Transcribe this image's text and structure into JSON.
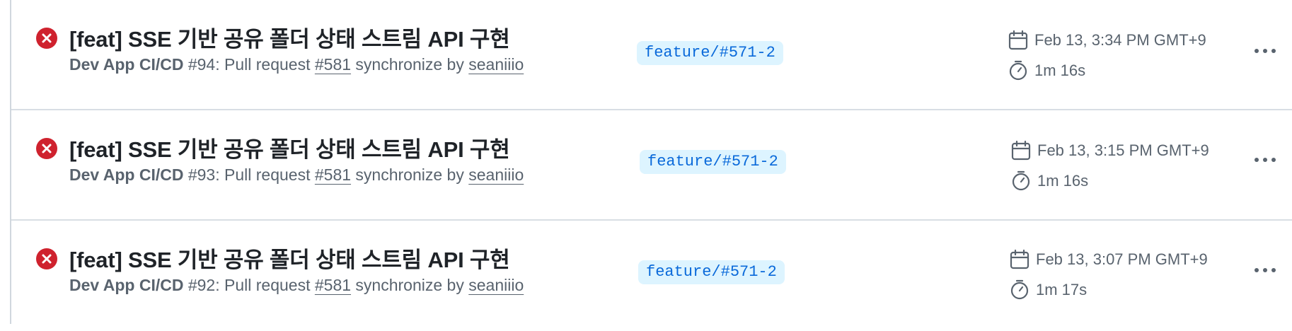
{
  "runs": [
    {
      "title": "[feat] SSE 기반 공유 폴더 상태 스트림 API 구현",
      "workflow": "Dev App CI/CD",
      "run_number": "#94",
      "event_text_1": ": Pull request ",
      "pr": "#581",
      "event_text_2": " synchronize by ",
      "actor": "seaniiio",
      "branch": "feature/#571-2",
      "timestamp": "Feb 13, 3:34 PM GMT+9",
      "duration": "1m 16s",
      "status": "failure"
    },
    {
      "title": "[feat] SSE 기반 공유 폴더 상태 스트림 API 구현",
      "workflow": "Dev App CI/CD",
      "run_number": "#93",
      "event_text_1": ": Pull request ",
      "pr": "#581",
      "event_text_2": " synchronize by ",
      "actor": "seaniiio",
      "branch": "feature/#571-2",
      "timestamp": "Feb 13, 3:15 PM GMT+9",
      "duration": "1m 16s",
      "status": "failure"
    },
    {
      "title": "[feat] SSE 기반 공유 폴더 상태 스트림 API 구현",
      "workflow": "Dev App CI/CD",
      "run_number": "#92",
      "event_text_1": ": Pull request ",
      "pr": "#581",
      "event_text_2": " synchronize by ",
      "actor": "seaniiio",
      "branch": "feature/#571-2",
      "timestamp": "Feb 13, 3:07 PM GMT+9",
      "duration": "1m 17s",
      "status": "failure"
    }
  ],
  "colors": {
    "failure": "#cf222e",
    "branch_bg": "#ddf4ff",
    "branch_fg": "#0969da",
    "muted": "#59636e"
  },
  "icons": {
    "status": "x-circle-fill-icon",
    "date": "calendar-icon",
    "duration": "stopwatch-icon",
    "menu": "kebab-horizontal-icon"
  }
}
